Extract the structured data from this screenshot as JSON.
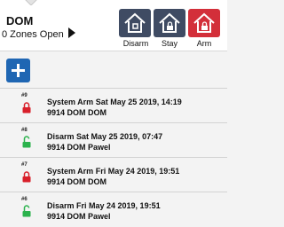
{
  "header": {
    "title": "DOM",
    "zones_status": "0 Zones Open"
  },
  "modes": {
    "disarm_label": "Disarm",
    "stay_label": "Stay",
    "arm_label": "Arm",
    "active": "Arm"
  },
  "toolbar": {
    "add_icon": "plus-icon"
  },
  "colors": {
    "mode_button": "#3f4b63",
    "arm_active": "#d32f3a",
    "add_button": "#1f66b3",
    "locked": "#d81f2a",
    "unlocked": "#2bb24c"
  },
  "events": [
    {
      "num": "#9",
      "state": "locked",
      "line1": "System Arm Sat May 25 2019, 14:19",
      "line2": "9914 DOM DOM"
    },
    {
      "num": "#8",
      "state": "unlocked",
      "line1": "Disarm Sat May 25 2019, 07:47",
      "line2": "9914 DOM Pawel"
    },
    {
      "num": "#7",
      "state": "locked",
      "line1": "System Arm Fri May 24 2019, 19:51",
      "line2": "9914 DOM DOM"
    },
    {
      "num": "#6",
      "state": "unlocked",
      "line1": "Disarm Fri May 24 2019, 19:51",
      "line2": "9914 DOM Pawel"
    }
  ]
}
